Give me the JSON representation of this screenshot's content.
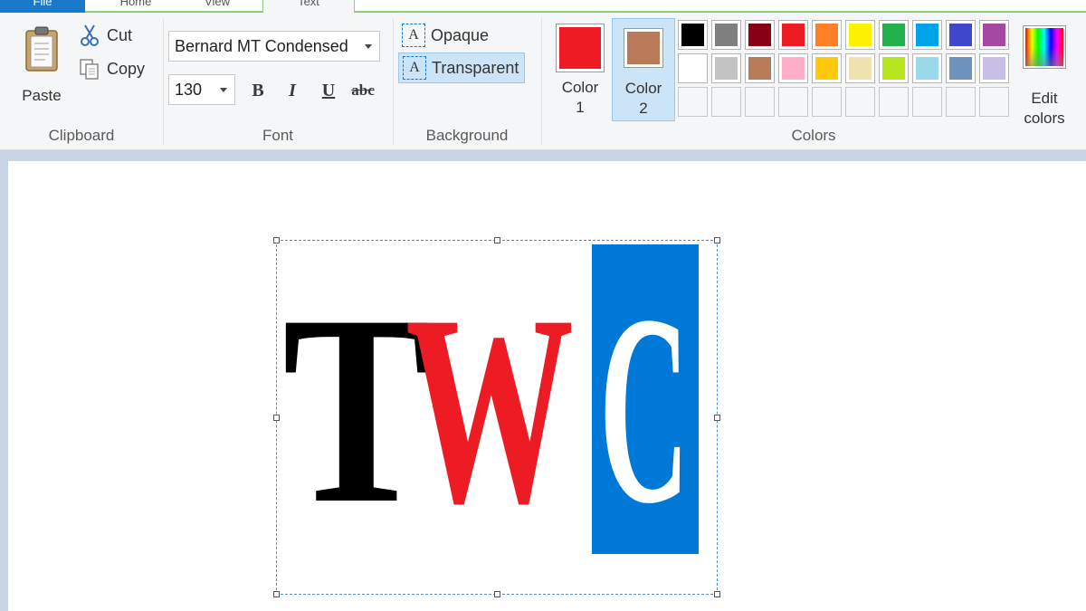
{
  "tabs": {
    "file": "File",
    "home": "Home",
    "view": "View",
    "text": "Text"
  },
  "clipboard": {
    "paste_label": "Paste",
    "cut_label": "Cut",
    "copy_label": "Copy",
    "group_label": "Clipboard"
  },
  "font": {
    "family": "Bernard MT Condensed",
    "size": "130",
    "bold_label": "B",
    "italic_label": "I",
    "underline_label": "U",
    "strike_label": "abc",
    "group_label": "Font"
  },
  "background": {
    "opaque_label": "Opaque",
    "transparent_label": "Transparent",
    "selected": "transparent",
    "group_label": "Background"
  },
  "colors": {
    "color1_label": "Color 1",
    "color1_line1": "Color",
    "color1_line2": "1",
    "color1_value": "#ed1c24",
    "color2_line1": "Color",
    "color2_line2": "2",
    "color2_value": "#b97a57",
    "selected": "color2",
    "edit_line1": "Edit",
    "edit_line2": "colors",
    "group_label": "Colors",
    "palette": [
      [
        "#000000",
        "#7f7f7f",
        "#880015",
        "#ed1c24",
        "#ff7f27",
        "#fff200",
        "#22b14c",
        "#00a2e8",
        "#3f48cc",
        "#a349a4"
      ],
      [
        "#ffffff",
        "#c3c3c3",
        "#b97a57",
        "#ffaec9",
        "#ffc90e",
        "#efe4b0",
        "#b5e61d",
        "#99d9ea",
        "#7092be",
        "#c8bfe7"
      ],
      [
        "",
        "",
        "",
        "",
        "",
        "",
        "",
        "",
        "",
        ""
      ]
    ]
  },
  "canvas": {
    "letter_1": "T",
    "letter_2": "W",
    "letter_3": "C",
    "letter_1_color": "#000000",
    "letter_2_color": "#ed1c24",
    "letter_3_color": "#ffffff",
    "letter_3_bg": "#0078d7"
  }
}
